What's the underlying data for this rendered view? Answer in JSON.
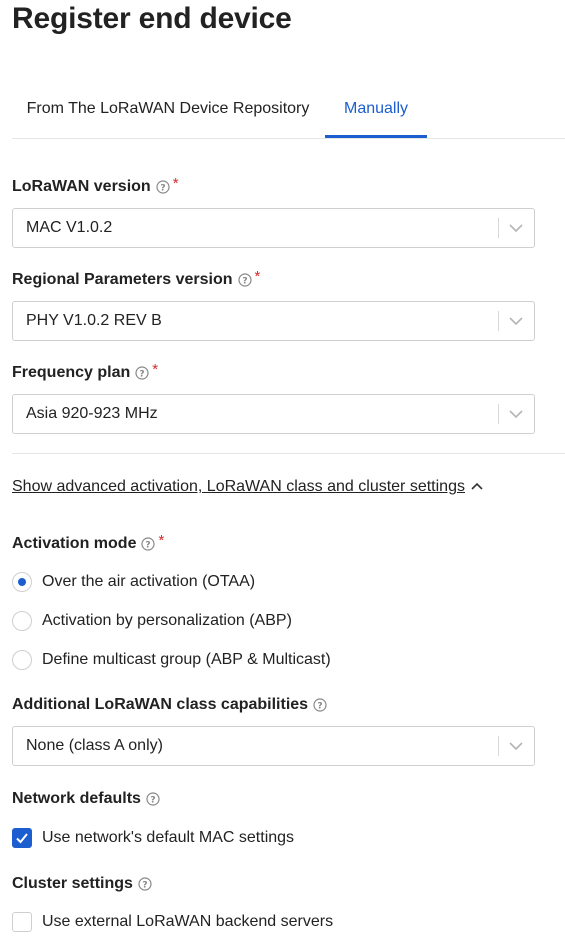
{
  "page": {
    "title": "Register end device"
  },
  "tabs": [
    {
      "label": "From The LoRaWAN Device Repository",
      "active": false
    },
    {
      "label": "Manually",
      "active": true
    }
  ],
  "fields": {
    "lorawan_version": {
      "label": "LoRaWAN version",
      "required": "*",
      "value": "MAC V1.0.2"
    },
    "regional_params": {
      "label": "Regional Parameters version",
      "required": "*",
      "value": "PHY V1.0.2 REV B"
    },
    "frequency_plan": {
      "label": "Frequency plan",
      "required": "*",
      "value": "Asia 920-923 MHz"
    }
  },
  "advanced_toggle": {
    "label": "Show advanced activation, LoRaWAN class and cluster settings",
    "expanded": true
  },
  "activation_mode": {
    "label": "Activation mode",
    "required": "*",
    "options": [
      {
        "label": "Over the air activation (OTAA)",
        "selected": true
      },
      {
        "label": "Activation by personalization (ABP)",
        "selected": false
      },
      {
        "label": "Define multicast group (ABP & Multicast)",
        "selected": false
      }
    ]
  },
  "class_capabilities": {
    "label": "Additional LoRaWAN class capabilities",
    "value": "None (class A only)"
  },
  "network_defaults": {
    "label": "Network defaults",
    "checkbox_label": "Use network's default MAC settings",
    "checked": true
  },
  "cluster_settings": {
    "label": "Cluster settings",
    "checkbox_label": "Use external LoRaWAN backend servers",
    "checked": false
  },
  "colors": {
    "accent": "#1c5ecf",
    "required": "#db2828",
    "text": "#222222",
    "border": "#cfcfcf"
  },
  "icons": {
    "help": "help-circle-icon",
    "chevron": "chevron-down-icon",
    "caret": "chevron-up-icon",
    "check": "checkmark-icon"
  }
}
